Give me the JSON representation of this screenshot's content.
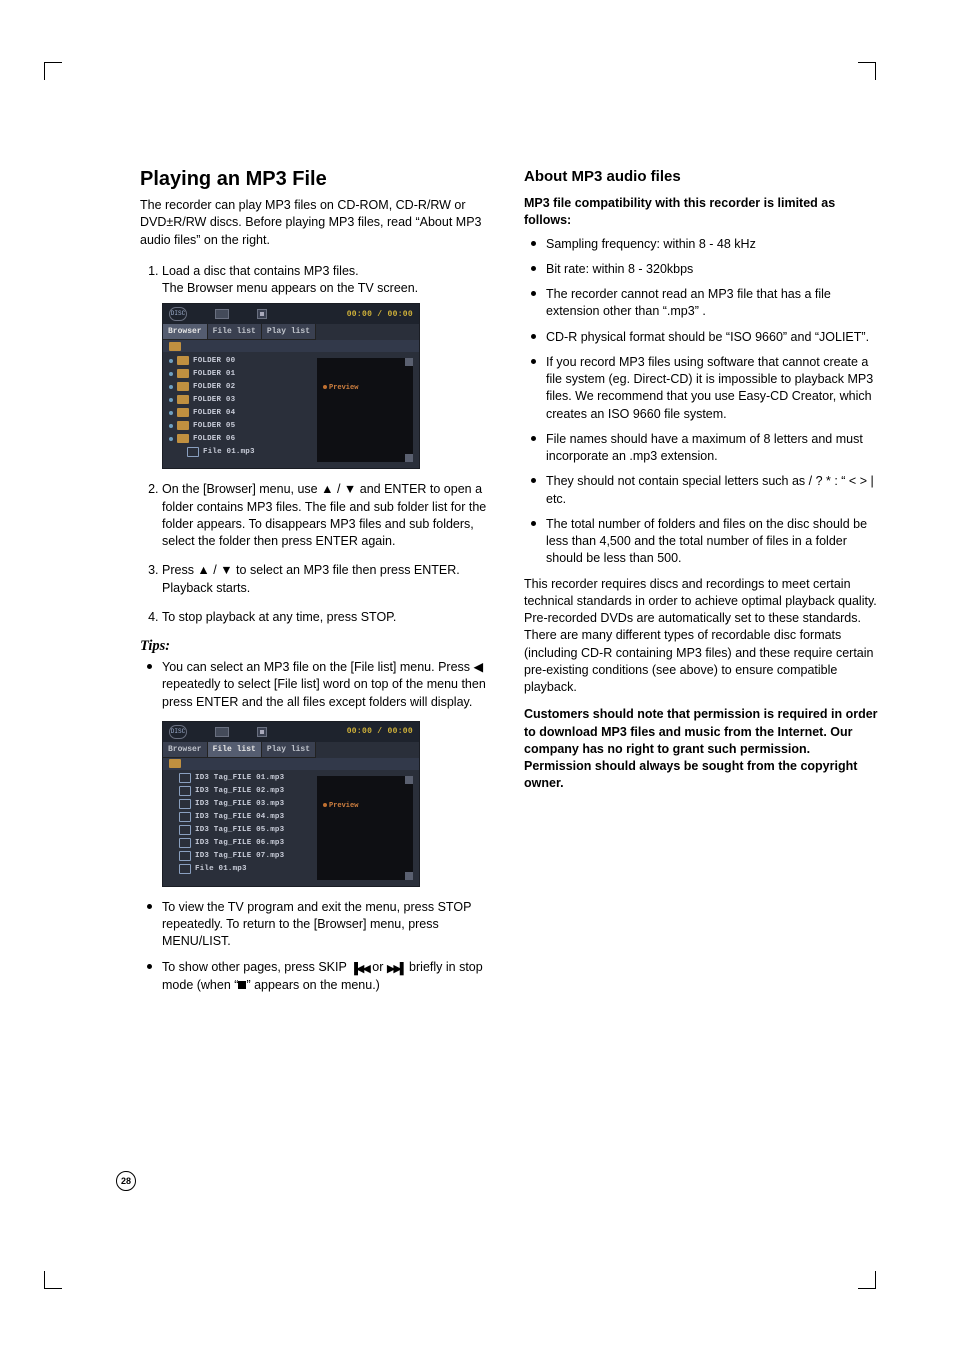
{
  "left": {
    "title": "Playing an MP3 File",
    "intro": "The recorder can play MP3 files on CD-ROM, CD-R/RW or DVD±R/RW discs. Before playing MP3 files, read “About MP3 audio files” on the right.",
    "steps": {
      "s1a": "Load a disc that contains MP3 files.",
      "s1b": "The Browser menu appears on the TV screen.",
      "s2": "On the [Browser] menu, use ▲ / ▼ and ENTER to open a folder contains MP3 files. The file and sub folder list for the folder appears. To disappears MP3 files and sub folders, select the folder then press ENTER again.",
      "s3": "Press ▲ / ▼ to select an MP3 file then press ENTER. Playback starts.",
      "s4": "To stop playback at any time, press STOP."
    },
    "tips_label": "Tips:",
    "tips": {
      "t1": "You can select an MP3 file on the [File list] menu. Press ◀ repeatedly to select [File list] word on top of the menu then press ENTER and the all files except folders will display.",
      "t2": "To view the TV program and exit the menu, press STOP repeatedly. To return to the [Browser] menu, press MENU/LIST.",
      "t3_a": "To show other pages, press SKIP ",
      "t3_b": " or ",
      "t3_c": " briefly in stop mode (when “",
      "t3_d": "” appears on the menu.)"
    },
    "screenshot1": {
      "tabs": {
        "browser": "Browser",
        "filelist": "File list",
        "playlist": "Play list"
      },
      "time": "00:00 / 00:00",
      "preview": "Preview",
      "folders": [
        "FOLDER 00",
        "FOLDER 01",
        "FOLDER 02",
        "FOLDER 03",
        "FOLDER 04",
        "FOLDER 05",
        "FOLDER 06"
      ],
      "last_file": "File 01.mp3"
    },
    "screenshot2": {
      "tabs": {
        "browser": "Browser",
        "filelist": "File list",
        "playlist": "Play list"
      },
      "time": "00:00 / 00:00",
      "preview": "Preview",
      "files": [
        "ID3 Tag_FILE 01.mp3",
        "ID3 Tag_FILE 02.mp3",
        "ID3 Tag_FILE 03.mp3",
        "ID3 Tag_FILE 04.mp3",
        "ID3 Tag_FILE 05.mp3",
        "ID3 Tag_FILE 06.mp3",
        "ID3 Tag_FILE 07.mp3"
      ],
      "last_file": "File 01.mp3"
    }
  },
  "right": {
    "title": "About MP3 audio files",
    "compat_heading": "MP3 file compatibility with this recorder is limited as follows:",
    "bullets": {
      "b1": "Sampling frequency: within 8 - 48 kHz",
      "b2": "Bit rate: within 8 - 320kbps",
      "b3": "The recorder cannot read an MP3 file that has a file extension other than “.mp3” .",
      "b4": "CD-R physical format should be “ISO 9660” and “JOLIET”.",
      "b5": "If you record MP3 files using software that cannot create a file system (eg. Direct-CD) it is impossible to playback MP3 files. We recommend that you use Easy-CD Creator, which creates an ISO 9660 file system.",
      "b6": "File names should have a maximum of 8 letters and must incorporate an .mp3 extension.",
      "b7": "They should not contain special letters such as  / ? * : “ < > | etc.",
      "b8": "The total number of folders and files on the disc should be less than 4,500 and the total number of files in a folder should be less than 500."
    },
    "para1": "This recorder requires discs and recordings to meet certain technical standards in order to achieve optimal playback quality. Pre-recorded DVDs are automatically set to these standards. There are many different types of recordable disc formats (including CD-R containing MP3 files) and these require certain pre-existing conditions (see above) to ensure compatible playback.",
    "para2": "Customers should note that permission is required in order to download MP3 files and music from the Internet. Our company has no right to grant such permission. Permission should always be sought from the copyright owner."
  },
  "page_number": "28"
}
